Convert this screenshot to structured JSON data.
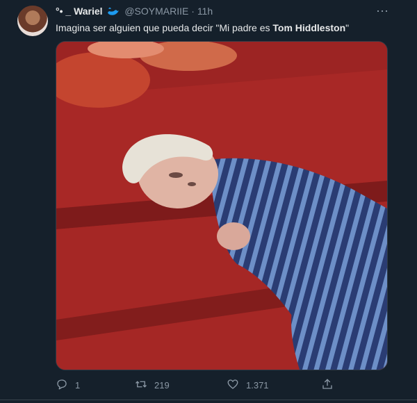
{
  "tweet": {
    "display_name": "°• _ Wariel",
    "handle": "@SOYMARIIE",
    "dot": "·",
    "time": "11h",
    "text_prefix": "Imagina ser alguien que pueda decir \"Mi padre es ",
    "text_bold": "Tom Hiddleston",
    "text_suffix": "\"",
    "more_icon": "more-dots-icon",
    "badge_icon": "whale-emoji-icon",
    "image_alt": "Photo of a person with short platinum hair in striped blue pajamas lying on red carpeted steps"
  },
  "actions": {
    "reply_count": "1",
    "retweet_count": "219",
    "like_count": "1.371"
  },
  "colors": {
    "background": "#15202b",
    "text": "#e7e9ea",
    "muted": "#8b98a5",
    "badge": "#1d9bf0"
  }
}
